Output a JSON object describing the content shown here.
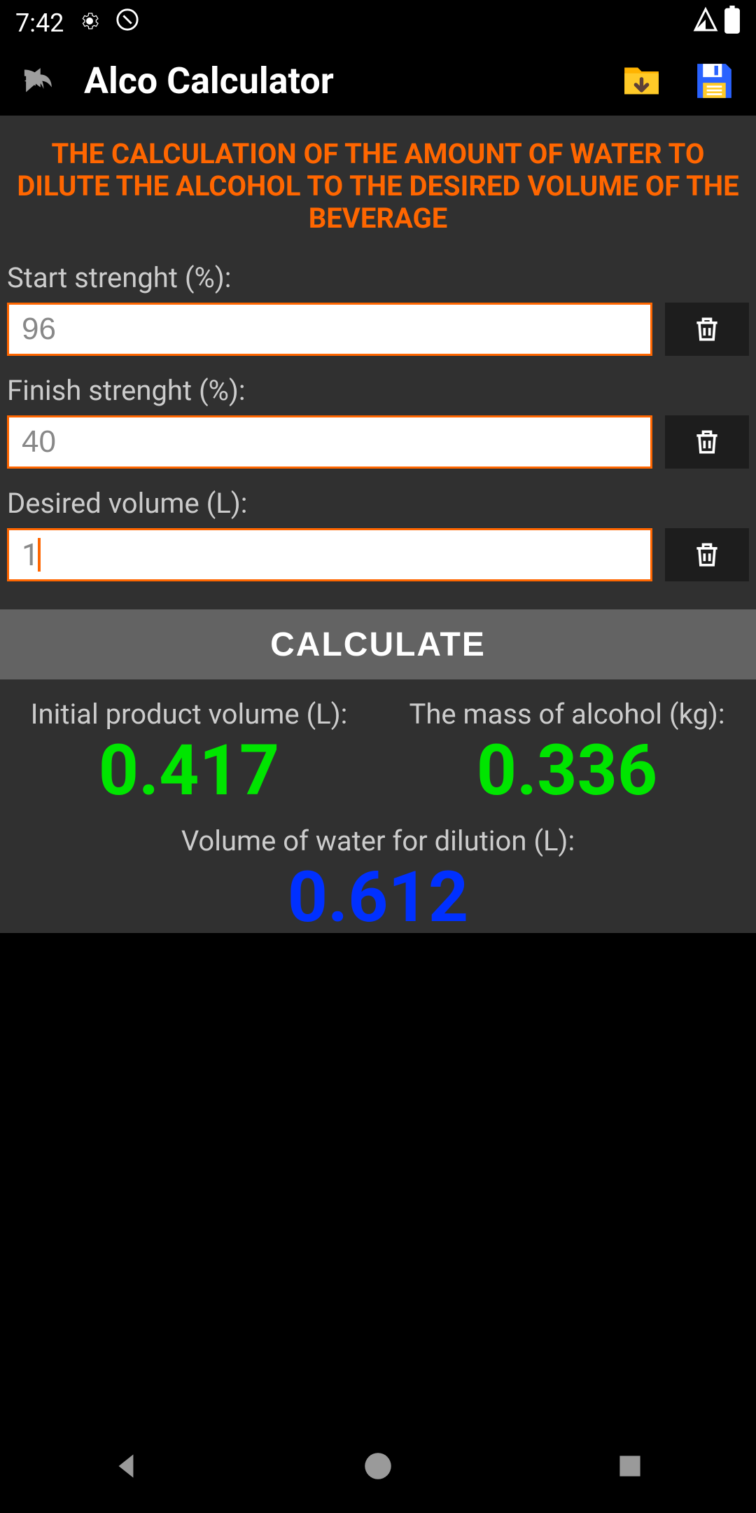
{
  "status": {
    "time": "7:42"
  },
  "appbar": {
    "title": "Alco Calculator"
  },
  "section": {
    "title": "THE CALCULATION OF THE AMOUNT OF WATER TO DILUTE THE ALCOHOL TO THE DESIRED VOLUME OF THE BEVERAGE"
  },
  "fields": {
    "start_strength": {
      "label": "Start strenght (%):",
      "value": "96"
    },
    "finish_strength": {
      "label": "Finish strenght (%):",
      "value": "40"
    },
    "desired_volume": {
      "label": "Desired volume (L):",
      "value": "1"
    }
  },
  "calculate_label": "CALCULATE",
  "results": {
    "initial_volume": {
      "label": "Initial product volume (L):",
      "value": "0.417"
    },
    "mass_alcohol": {
      "label": "The mass of alcohol (kg):",
      "value": "0.336"
    },
    "water_volume": {
      "label": "Volume of water for dilution (L):",
      "value": "0.612"
    }
  }
}
